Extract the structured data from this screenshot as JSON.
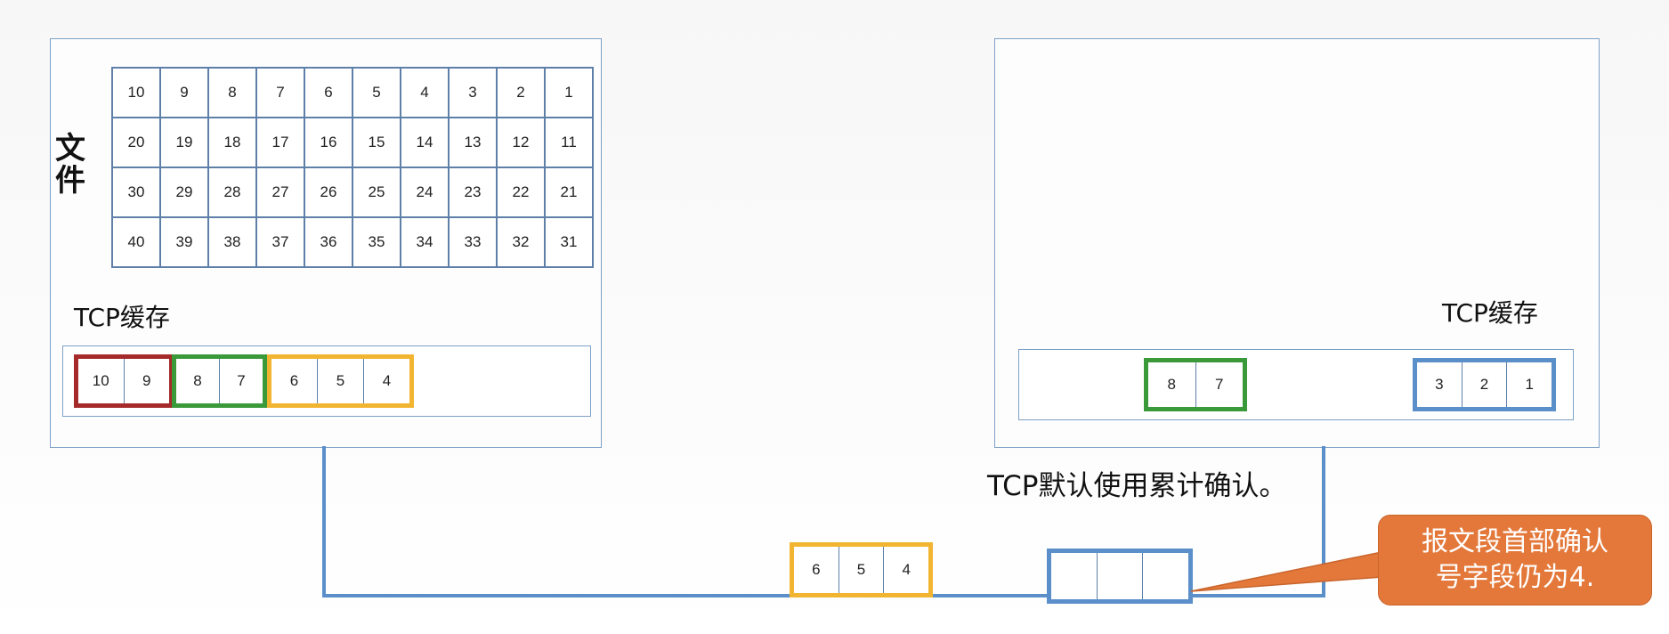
{
  "file_label": "文件",
  "file_rows": [
    [
      "10",
      "9",
      "8",
      "7",
      "6",
      "5",
      "4",
      "3",
      "2",
      "1"
    ],
    [
      "20",
      "19",
      "18",
      "17",
      "16",
      "15",
      "14",
      "13",
      "12",
      "11"
    ],
    [
      "30",
      "29",
      "28",
      "27",
      "26",
      "25",
      "24",
      "23",
      "22",
      "21"
    ],
    [
      "40",
      "39",
      "38",
      "37",
      "36",
      "35",
      "34",
      "33",
      "32",
      "31"
    ]
  ],
  "sender": {
    "cache_label": "TCP缓存",
    "segments": [
      {
        "cells": [
          "10",
          "9"
        ],
        "color": "#a52a2a"
      },
      {
        "cells": [
          "8",
          "7"
        ],
        "color": "#3a9a3a"
      },
      {
        "cells": [
          "6",
          "5",
          "4"
        ],
        "color": "#f2b531"
      }
    ]
  },
  "receiver": {
    "cache_label": "TCP缓存",
    "segments": [
      {
        "cells": [
          "8",
          "7"
        ],
        "color": "#3a9a3a"
      },
      {
        "cells": [
          "3",
          "2",
          "1"
        ],
        "color": "#5b8fc9"
      }
    ]
  },
  "in_transit": {
    "data_segment": {
      "cells": [
        "6",
        "5",
        "4"
      ],
      "color": "#f2b531"
    },
    "ack_segment": {
      "cells": [
        "",
        "",
        ""
      ],
      "color": "#5b8fc9"
    }
  },
  "note": "TCP默认使用累计确认。",
  "callout": {
    "line1": "报文段首部确认",
    "line2": "号字段仍为4.",
    "color": "#e3783a"
  }
}
